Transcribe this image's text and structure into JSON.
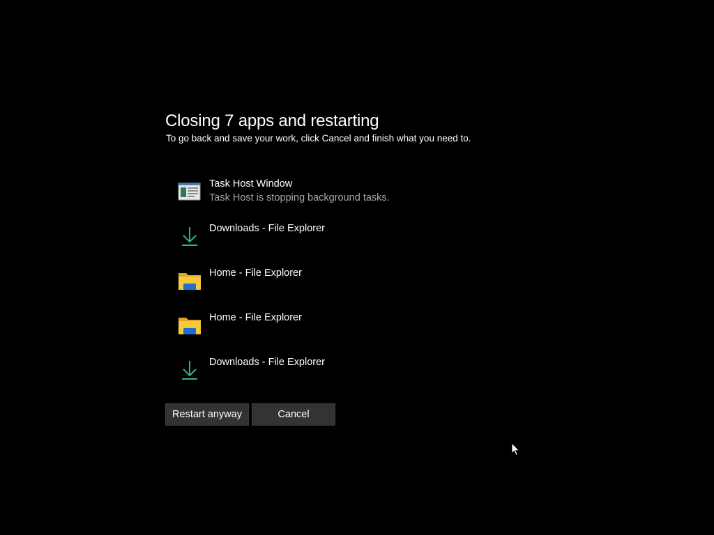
{
  "dialog": {
    "title": "Closing 7 apps and restarting",
    "subtitle": "To go back and save your work, click Cancel and finish what you need to."
  },
  "apps": [
    {
      "name": "Task Host Window",
      "status": "Task Host is stopping background tasks.",
      "icon": "task-host-icon"
    },
    {
      "name": "Downloads - File Explorer",
      "status": "",
      "icon": "download-arrow-icon"
    },
    {
      "name": "Home - File Explorer",
      "status": "",
      "icon": "folder-icon"
    },
    {
      "name": "Home - File Explorer",
      "status": "",
      "icon": "folder-icon"
    },
    {
      "name": "Downloads - File Explorer",
      "status": "",
      "icon": "download-arrow-icon"
    }
  ],
  "buttons": {
    "restart_label": "Restart anyway",
    "cancel_label": "Cancel"
  },
  "colors": {
    "background": "#000000",
    "text": "#ffffff",
    "secondary_text": "#a6a6a6",
    "button_bg": "#333333",
    "download_arrow": "#2db87d",
    "folder_yellow": "#f8c83c",
    "folder_blue": "#1e6fd0"
  }
}
